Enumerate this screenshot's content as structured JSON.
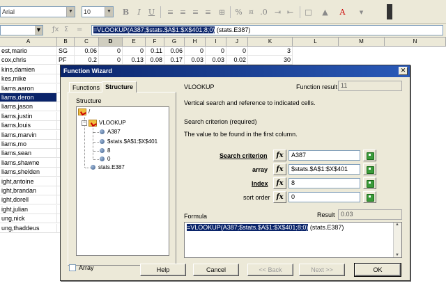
{
  "toolbar": {
    "font_name": "Arial",
    "font_size": "10",
    "icons": [
      "bold-icon",
      "italic-icon",
      "underline-icon",
      "align-left-icon",
      "align-center-icon",
      "align-right-icon",
      "justify-icon",
      "merge-icon",
      "percent-icon",
      "currency-icon",
      "decimal-icon",
      "indent-icon",
      "outdent-icon",
      "border-icon",
      "background-color-icon",
      "font-color-icon"
    ]
  },
  "formula_bar": {
    "name_box": "",
    "formula_selected": "=VLOOKUP(A387;$stats.$A$1:$X$401;8;0)",
    "formula_rest": " (stats.E387)"
  },
  "columns": [
    "A",
    "B",
    "C",
    "D",
    "E",
    "F",
    "G",
    "H",
    "I",
    "J",
    "K",
    "L",
    "M",
    "N"
  ],
  "active_column": "D",
  "rows": [
    [
      "est,mario",
      "SG",
      "0.06",
      "0",
      "0",
      "0.11",
      "0.06",
      "0",
      "0",
      "0",
      "3"
    ],
    [
      "cox,chris",
      "PF",
      "0.2",
      "0",
      "0.13",
      "0.08",
      "0.17",
      "0.03",
      "0.03",
      "0.02",
      "30"
    ],
    [
      "kins,damien",
      "",
      ""
    ],
    [
      "kes,mike",
      "",
      ""
    ],
    [
      "liams,aaron",
      "",
      ""
    ],
    [
      "liams,deron",
      "",
      ""
    ],
    [
      "liams,jason",
      "",
      ""
    ],
    [
      "liams,justin",
      "",
      ""
    ],
    [
      "liams,louis",
      "",
      ""
    ],
    [
      "liams,marvin",
      "",
      ""
    ],
    [
      "liams,mo",
      "",
      ""
    ],
    [
      "liams,sean",
      "",
      ""
    ],
    [
      "liams,shawne",
      "",
      ""
    ],
    [
      "liams,shelden",
      "",
      ""
    ],
    [
      "ight,antoine",
      "",
      ""
    ],
    [
      "ight,brandan",
      "",
      ""
    ],
    [
      "ight,dorell",
      "",
      ""
    ],
    [
      "ight,julian",
      "",
      ""
    ],
    [
      "ung,nick",
      "",
      ""
    ],
    [
      "ung,thaddeus",
      "",
      ""
    ]
  ],
  "highlighted_row": 5,
  "dialog": {
    "title": "Function Wizard",
    "tabs": [
      "Functions",
      "Structure"
    ],
    "active_tab": "Structure",
    "structure_label": "Structure",
    "tree": {
      "root": "/",
      "function": "VLOOKUP",
      "args": [
        "A387",
        "$stats.$A$1:$X$401",
        "8",
        "0"
      ],
      "sibling": "stats.E387"
    },
    "function_name": "VLOOKUP",
    "function_result_label": "Function result",
    "function_result": "11",
    "description": "Vertical search and reference to indicated cells.",
    "param_title": "Search criterion (required)",
    "param_desc": "The value to be found in the first column.",
    "params": [
      {
        "label": "Search criterion",
        "value": "A387",
        "bold": true
      },
      {
        "label": "array",
        "value": "$stats.$A$1:$X$401",
        "bold": true
      },
      {
        "label": "Index",
        "value": "8",
        "bold": true
      },
      {
        "label": "sort order",
        "value": "0",
        "bold": false
      }
    ],
    "fx_label": "fx",
    "formula_label": "Formula",
    "result_label": "Result",
    "result_value": "0.03",
    "formula_selected": "=VLOOKUP(A387;$stats.$A$1:$X$401;8;0)",
    "formula_rest": " (stats.E387)",
    "array_label": "Array",
    "buttons": {
      "help": "Help",
      "cancel": "Cancel",
      "back": "<< Back",
      "next": "Next >>",
      "ok": "OK"
    }
  }
}
